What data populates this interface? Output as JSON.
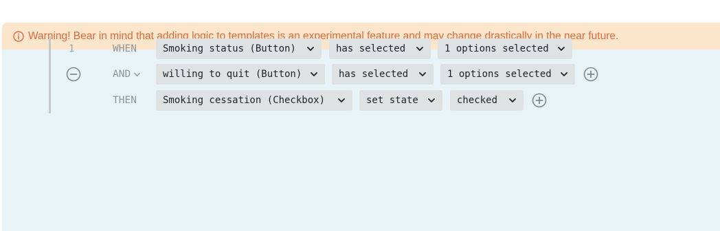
{
  "warning": {
    "text": "Warning! Bear in mind that adding logic to templates is an experimental feature and may change drastically in the near future.",
    "icon": "info-circle-icon",
    "color": "#dc6a3c"
  },
  "rule": {
    "number": "1",
    "rows": [
      {
        "keyword": "WHEN",
        "field": "Smoking status (Button)",
        "operator": "has selected",
        "value": "1 options selected"
      },
      {
        "keyword": "AND",
        "field": "willing to quit (Button)",
        "operator": "has selected",
        "value": "1 options selected"
      },
      {
        "keyword": "THEN",
        "field": "Smoking cessation (Checkbox)",
        "operator": "set state",
        "value": "checked"
      }
    ]
  }
}
